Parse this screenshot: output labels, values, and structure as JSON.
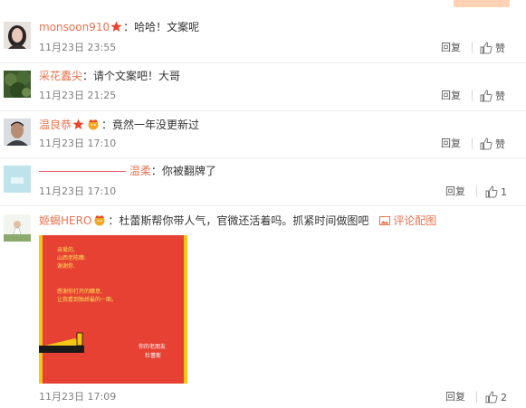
{
  "comments": [
    {
      "user": "monsoon910",
      "text": "哈哈！文案呢",
      "time": "11月23日 23:55",
      "reply": "回复",
      "like": "赞"
    },
    {
      "user": "采花蠹尖",
      "text": "请个文案吧！大哥",
      "time": "11月23日 21:25",
      "reply": "回复",
      "like": "赞"
    },
    {
      "user": "温良恭",
      "text": "竟然一年没更新过",
      "time": "11月23日 17:10",
      "reply": "回复",
      "like": "赞"
    },
    {
      "user": "温柔",
      "text": "你被翻牌了",
      "time": "11月23日 17:10",
      "reply": "回复",
      "like": "1"
    },
    {
      "user": "姬蝎HERO",
      "text": "杜蕾斯帮你带人气，官微还活着吗。抓紧时间做图吧",
      "time": "11月23日 17:09",
      "reply": "回复",
      "like": "2",
      "image_link": "评论配图"
    }
  ],
  "comment_image": {
    "lines": [
      "亲爱的,",
      "山西老陈醋:",
      "谢谢你.",
      "",
      "感谢你打开的醋意,",
      "让我看到独娇最的一面。"
    ],
    "sign": [
      "你的老朋友",
      "杜蕾斯"
    ]
  },
  "colors": {
    "username": "#eb7350",
    "meta": "#808080",
    "image_bg": "#e64132",
    "image_border": "#f5c518"
  }
}
